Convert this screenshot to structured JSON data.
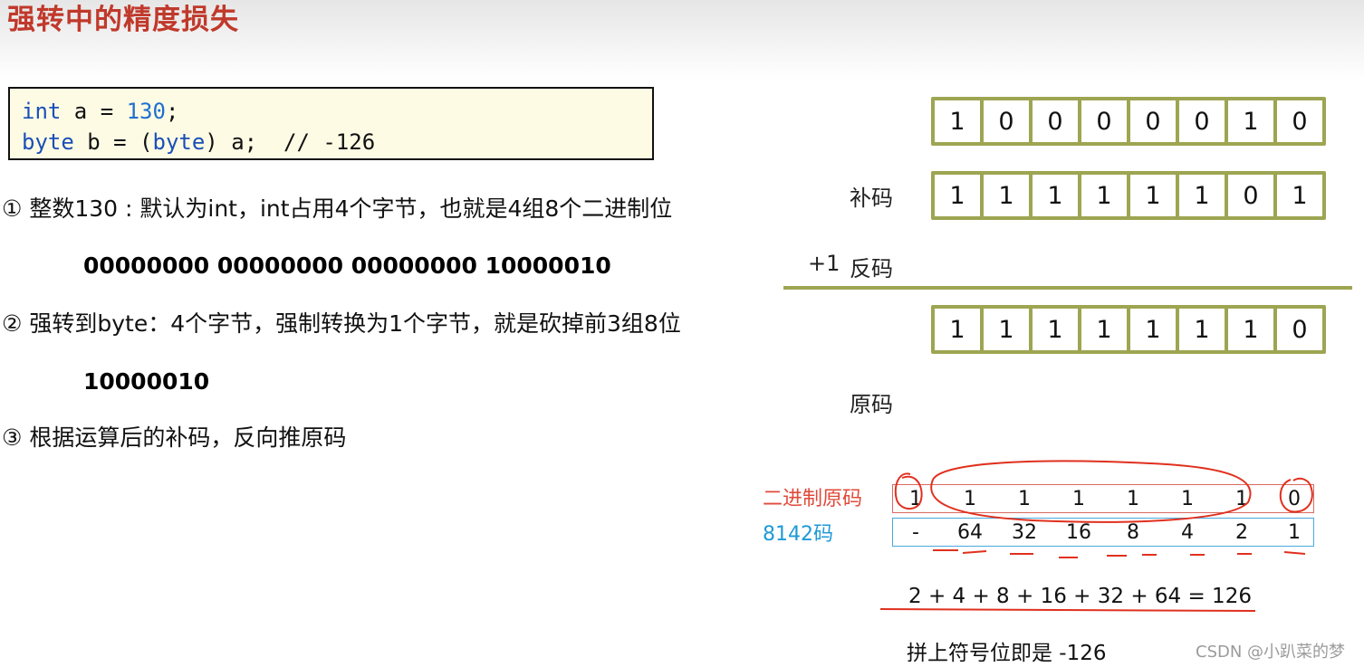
{
  "title": "强转中的精度损失",
  "code": {
    "line1": {
      "kw": "int",
      "mid": " a = ",
      "num": "130",
      "end": ";"
    },
    "line2": {
      "kw1": "byte",
      "mid1": " b = (",
      "kw2": "byte",
      "rest": ") a;  // -126"
    }
  },
  "steps": [
    {
      "text": "① 整数130 : 默认为int，int占用4个字节，也就是4组8个二进制位",
      "binary": "00000000 00000000 00000000 10000010"
    },
    {
      "text": "② 强转到byte：4个字节，强制转换为1个字节，就是砍掉前3组8位",
      "binary": "10000010"
    },
    {
      "text": "③ 根据运算后的补码，反向推原码"
    }
  ],
  "diagram": {
    "row1_bits": [
      "1",
      "0",
      "0",
      "0",
      "0",
      "0",
      "1",
      "0"
    ],
    "row2_label": "补码",
    "row2_bits": [
      "1",
      "1",
      "1",
      "1",
      "1",
      "1",
      "0",
      "1"
    ],
    "plus_one_label": "+1",
    "inverse_label": "反码",
    "row3_bits": [
      "1",
      "1",
      "1",
      "1",
      "1",
      "1",
      "1",
      "0"
    ],
    "original_label": "原码"
  },
  "annotation": {
    "binary_label": "二进制原码",
    "weight_label": "8142码",
    "binary_bits": [
      "1",
      "1",
      "1",
      "1",
      "1",
      "1",
      "1",
      "0"
    ],
    "weights": [
      "-",
      "64",
      "32",
      "16",
      "8",
      "4",
      "2",
      "1"
    ],
    "sum": "2 + 4 + 8 + 16 + 32 + 64 = 126",
    "conclusion": "拼上符号位即是 -126",
    "ink_color": "#e0301e"
  },
  "watermark": "CSDN @小趴菜的梦"
}
